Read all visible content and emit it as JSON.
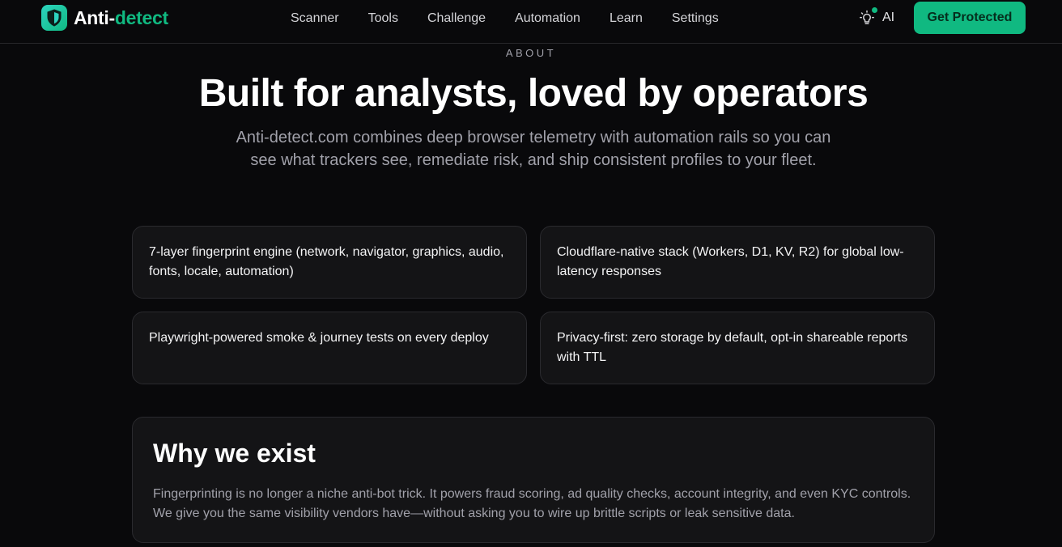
{
  "brand": {
    "part1": "Anti-",
    "part2": "detect"
  },
  "nav": [
    "Scanner",
    "Tools",
    "Challenge",
    "Automation",
    "Learn",
    "Settings"
  ],
  "ai_label": "AI",
  "cta_label": "Get Protected",
  "hero": {
    "eyebrow": "ABOUT",
    "title": "Built for analysts, loved by operators",
    "lead": "Anti-detect.com combines deep browser telemetry with automation rails so you can see what trackers see, remediate risk, and ship consistent profiles to your fleet."
  },
  "features": [
    "7-layer fingerprint engine (network, navigator, graphics, audio, fonts, locale, automation)",
    "Cloudflare-native stack (Workers, D1, KV, R2) for global low-latency responses",
    "Playwright-powered smoke & journey tests on every deploy",
    "Privacy-first: zero storage by default, opt-in shareable reports with TTL"
  ],
  "why": {
    "title": "Why we exist",
    "body": "Fingerprinting is no longer a niche anti-bot trick. It powers fraud scoring, ad quality checks, account integrity, and even KYC controls. We give you the same visibility vendors have—without asking you to wire up brittle scripts or leak sensitive data."
  },
  "colors": {
    "accent": "#10b981",
    "background": "#09090b",
    "card": "#141416",
    "muted": "#a1a1aa"
  },
  "icons": {
    "logo": "shield-icon",
    "ai": "lightbulb-icon"
  }
}
